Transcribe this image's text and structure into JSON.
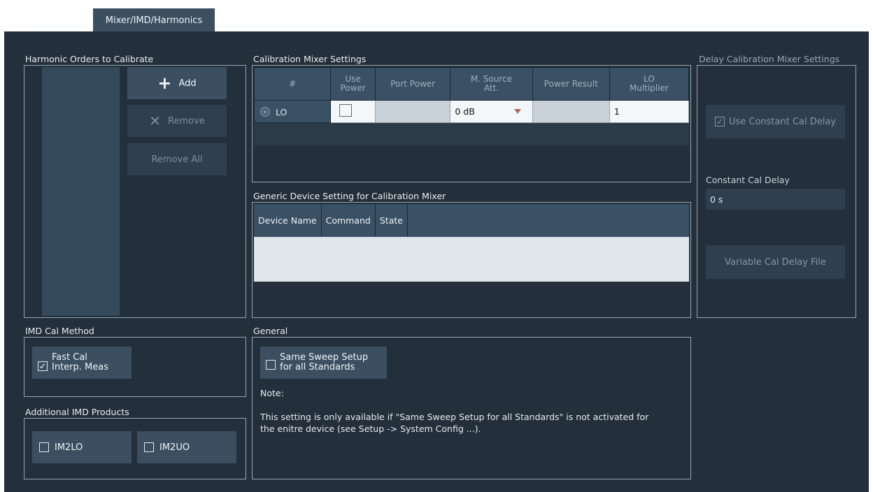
{
  "tab": {
    "label": "Mixer/IMD/Harmonics"
  },
  "harmonics": {
    "title": "Harmonic Orders to Calibrate",
    "add_label": "Add",
    "remove_label": "Remove",
    "remove_all_label": "Remove All"
  },
  "cal_mixer": {
    "title": "Calibration Mixer Settings",
    "columns": [
      "#",
      "Use Power",
      "Port Power",
      "M. Source Att.",
      "Power Result",
      "LO Multiplier"
    ],
    "row": {
      "name": "LO",
      "use_power": false,
      "port_power": "",
      "source_att": "0 dB",
      "power_result": "",
      "lo_multiplier": "1"
    }
  },
  "generic_device": {
    "title": "Generic Device Setting for Calibration Mixer",
    "columns": [
      "Device Name",
      "Command",
      "State"
    ]
  },
  "delay": {
    "title": "Delay Calibration Mixer Settings",
    "use_constant_label": "Use Constant Cal Delay",
    "use_constant_checked": true,
    "constant_label": "Constant Cal Delay",
    "constant_value": "0 s",
    "variable_file_label": "Variable Cal Delay File"
  },
  "imd_method": {
    "title": "IMD Cal Method",
    "fast_cal_line1": "Fast Cal",
    "fast_cal_line2": "Interp. Meas",
    "fast_cal_checked": true
  },
  "additional_imd": {
    "title": "Additional IMD Products",
    "im2lo_label": "IM2LO",
    "im2uo_label": "IM2UO"
  },
  "general": {
    "title": "General",
    "same_sweep_line1": "Same Sweep Setup",
    "same_sweep_line2": "for all Standards",
    "note_label": "Note:",
    "note_line1": "This setting is only available if \"Same Sweep Setup for all Standards\" is not activated for",
    "note_line2": "the enitre device (see Setup -> System Config ...)."
  }
}
